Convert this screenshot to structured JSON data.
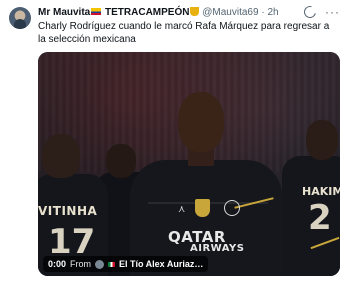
{
  "tweet": {
    "display_name": "Mr Mauvita",
    "display_name_suffix": "TETRACAMPEÓN",
    "handle": "@Mauvita69",
    "separator": "·",
    "time": "2h",
    "text": "Charly Rodríguez cuando le marcó Rafa Márquez para regresar a la selección mexicana"
  },
  "video": {
    "time": "0:00",
    "from_label": "From",
    "source_name": "El Tío Alex Auriaz…",
    "jersey_left_name": "VITINHA",
    "jersey_left_number": "17",
    "jersey_right_name": "HAKIM",
    "jersey_right_number": "2",
    "sponsor_main": "QATAR",
    "sponsor_sub": "AIRWAYS"
  },
  "icons": {
    "grok": "grok-icon",
    "more": "more-icon"
  }
}
